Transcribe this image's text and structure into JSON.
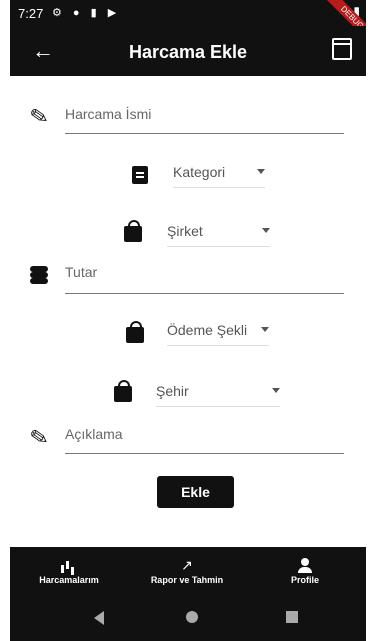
{
  "statusbar": {
    "time": "7:27",
    "debug_banner": "DEBUG"
  },
  "appbar": {
    "title": "Harcama Ekle"
  },
  "form": {
    "name_placeholder": "Harcama İsmi",
    "category_selected": "Kategori",
    "company_selected": "Şirket",
    "amount_placeholder": "Tutar",
    "payment_selected": "Ödeme Şekli",
    "city_selected": "Şehir",
    "description_placeholder": "Açıklama",
    "submit_label": "Ekle"
  },
  "bottom_nav": [
    {
      "label": "Harcamalarım",
      "icon": "bar-chart-icon"
    },
    {
      "label": "Rapor ve Tahmin",
      "icon": "trending-up-icon"
    },
    {
      "label": "Profile",
      "icon": "person-icon"
    }
  ],
  "colors": {
    "dark": "#111111",
    "background": "#ffffff"
  }
}
